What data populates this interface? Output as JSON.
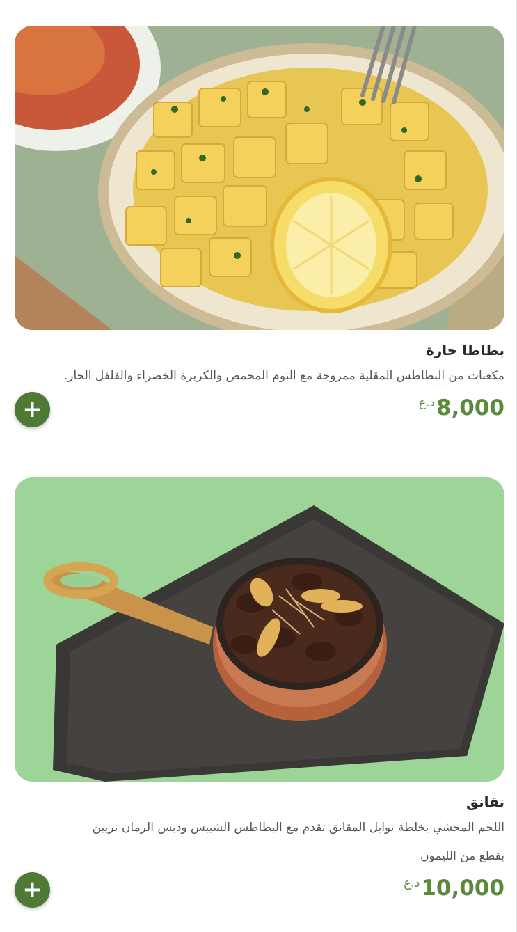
{
  "items": [
    {
      "title": "بطاطا حارة",
      "description": "مكعبات من البطاطس المقلية ممزوجة مع التوم المحمص والكزبرة الخضراء والفلفل الحار.",
      "price": "8,000",
      "currency": "د.ع",
      "add_label": "+",
      "image_icon": "spicy-potato-dish-photo"
    },
    {
      "title": "نقانق",
      "description_lines": [
        "اللحم المحشي بخلطة توابل المقانق تقدم مع البطاطس الشيبس ودبس الرمان تزيين",
        "بقطع من الليمون"
      ],
      "price": "10,000",
      "currency": "د.ع",
      "add_label": "+",
      "image_icon": "sausage-pan-photo"
    }
  ],
  "colors": {
    "accent": "#4f7a35",
    "price": "#5a8a3a"
  }
}
